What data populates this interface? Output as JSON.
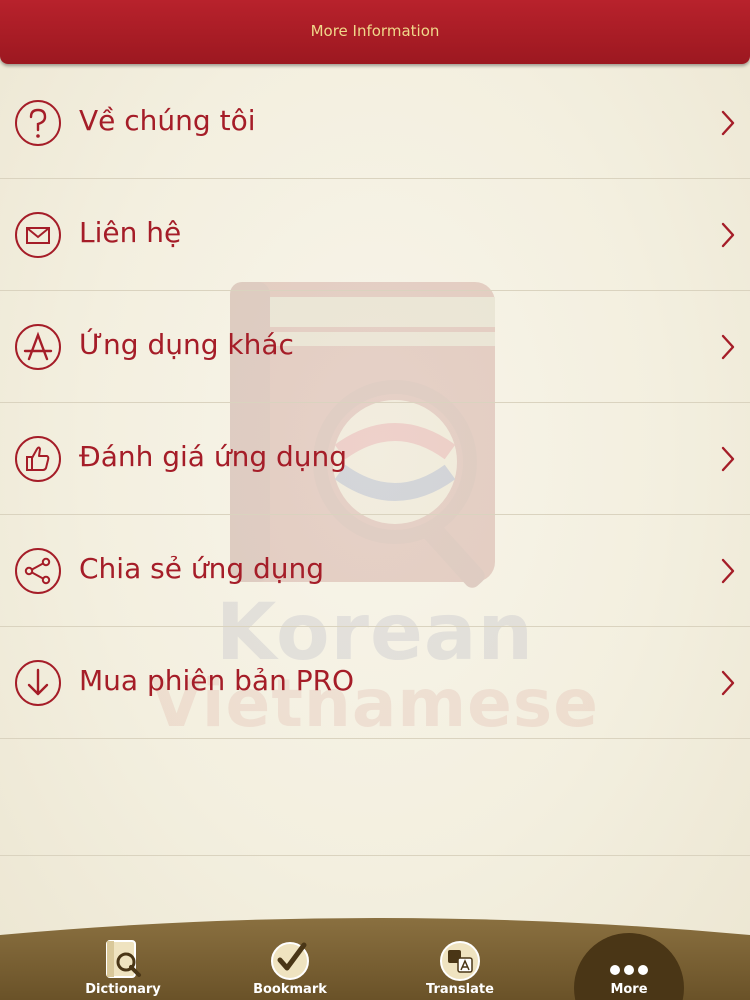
{
  "header": {
    "title": "More Information"
  },
  "menu": {
    "items": [
      {
        "label": "Về chúng tôi",
        "icon": "question-icon"
      },
      {
        "label": "Liên hệ",
        "icon": "envelope-icon"
      },
      {
        "label": "Ứng dụng khác",
        "icon": "app-store-icon"
      },
      {
        "label": "Đánh giá ứng dụng",
        "icon": "thumbs-up-icon"
      },
      {
        "label": "Chia sẻ ứng dụng",
        "icon": "share-icon"
      },
      {
        "label": "Mua phiên bản PRO",
        "icon": "download-icon"
      }
    ]
  },
  "watermark": {
    "line1": "Korean",
    "line2": "Vietnamese"
  },
  "tabbar": {
    "tabs": [
      {
        "label": "Dictionary",
        "icon": "dictionary-icon"
      },
      {
        "label": "Bookmark",
        "icon": "bookmark-check-icon"
      },
      {
        "label": "Translate",
        "icon": "translate-icon"
      },
      {
        "label": "More",
        "icon": "more-dots-icon",
        "selected": true
      }
    ]
  },
  "colors": {
    "header_red": "#a51d28",
    "header_text": "#f0d88a",
    "label_red": "#a51d28",
    "paper": "#f5f1e3",
    "tabbar_brown": "#7a6233"
  }
}
